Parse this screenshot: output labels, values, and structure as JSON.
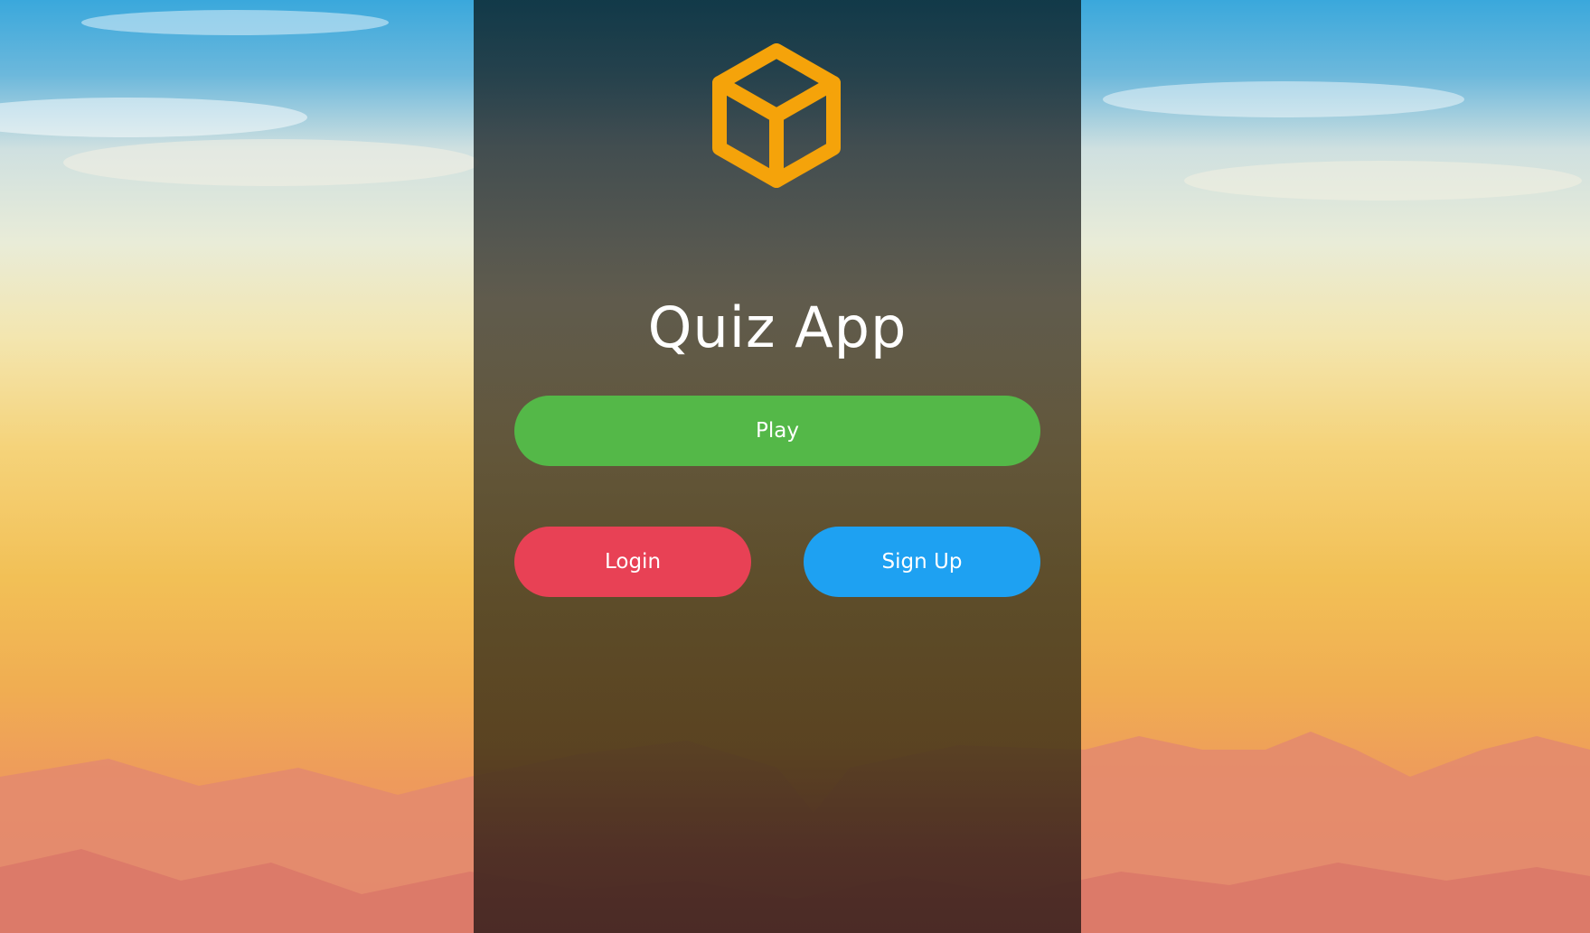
{
  "app": {
    "title": "Quiz App",
    "logo_icon": "cube-icon",
    "logo_color": "#f5a30a"
  },
  "actions": {
    "play_label": "Play",
    "login_label": "Login",
    "signup_label": "Sign Up"
  },
  "colors": {
    "play": "#54b848",
    "login": "#e84155",
    "signup": "#1ea1f2"
  }
}
